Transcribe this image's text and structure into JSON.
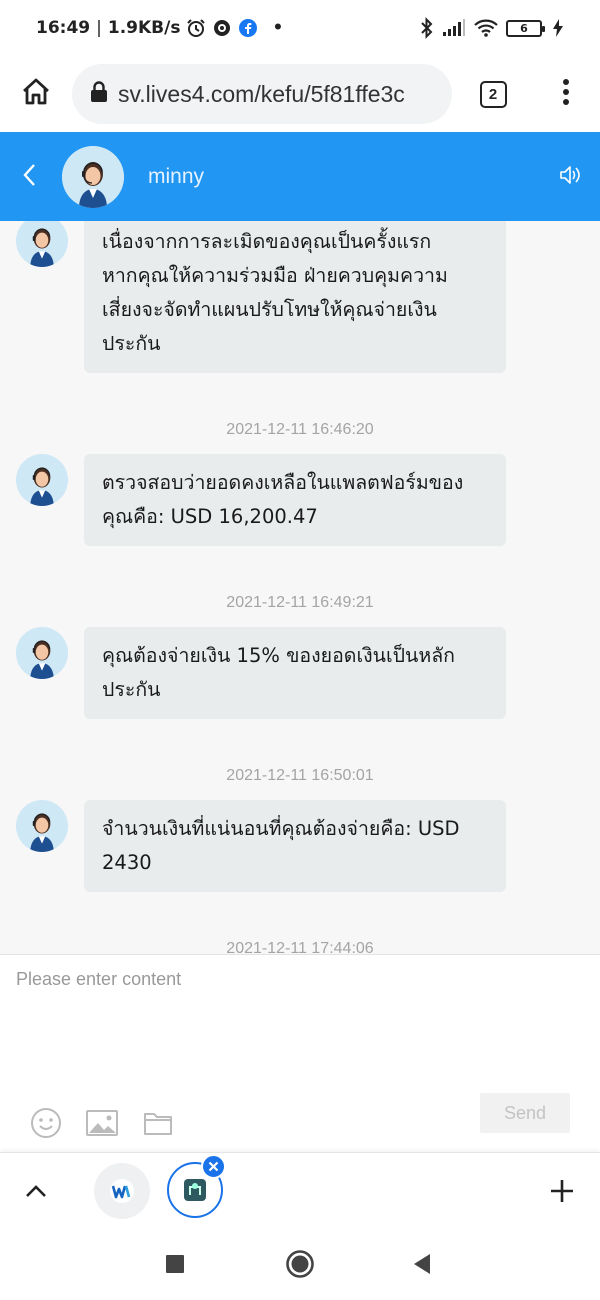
{
  "status_bar": {
    "time": "16:49",
    "separator": "|",
    "net_speed": "1.9KB/s",
    "dot": "•",
    "battery_level": "6",
    "icons": [
      "alarm-icon",
      "vpn-icon",
      "facebook-icon",
      "bluetooth-icon",
      "signal-icon",
      "wifi-icon",
      "battery-icon",
      "charging-icon"
    ]
  },
  "browser": {
    "url": "sv.lives4.com/kefu/5f81ffe3c",
    "tab_count": "2"
  },
  "chat": {
    "agent_name": "minny",
    "header_color": "#2196f3",
    "messages": [
      {
        "text": "เนื่องจากการละเมิดของคุณเป็นครั้งแรก\nหากคุณให้ความร่วมมือ ฝ่ายควบคุมความ\nเสี่ยงจะจัดทำแผนปรับโทษให้คุณจ่ายเงิน\nประกัน"
      },
      {
        "timestamp": "2021-12-11 16:46:20",
        "text": "ตรวจสอบว่ายอดคงเหลือในแพลตฟอร์มของ\nคุณคือ: USD 16,200.47"
      },
      {
        "timestamp": "2021-12-11 16:49:21",
        "text": "คุณต้องจ่ายเงิน 15% ของยอดเงินเป็นหลัก\nประกัน"
      },
      {
        "timestamp": "2021-12-11 16:50:01",
        "text": "จำนวนเงินที่แน่นอนที่คุณต้องจ่ายคือ: USD\n2430"
      }
    ],
    "partial_timestamp": "2021-12-11 17:44:06"
  },
  "composer": {
    "placeholder": "Please enter content",
    "send_label": "Send"
  },
  "colors": {
    "accent": "#2196f3",
    "bubble": "#e8eced",
    "timestamp": "#a4a4a4",
    "tab_ring": "#1a73e8"
  }
}
